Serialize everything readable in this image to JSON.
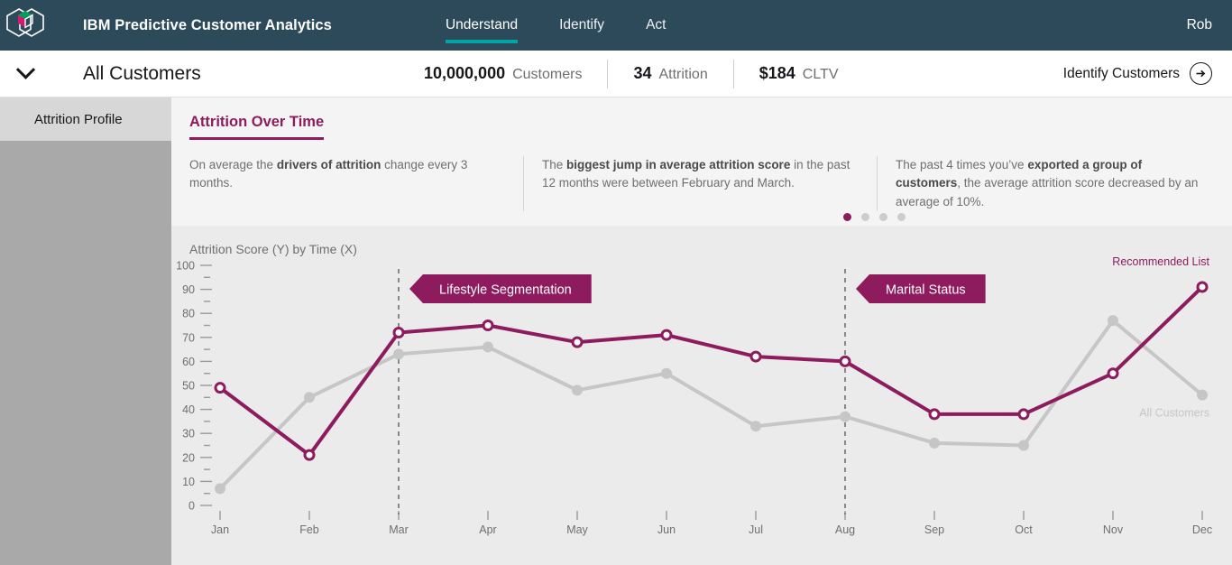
{
  "header": {
    "logo_icon": "ibm-cube-logo-icon",
    "app_title": "IBM Predictive Customer Analytics",
    "nav": [
      {
        "label": "Understand",
        "active": true
      },
      {
        "label": "Identify",
        "active": false
      },
      {
        "label": "Act",
        "active": false
      }
    ],
    "user": "Rob",
    "accent_color": "#00a5a8",
    "bg_color": "#2d4a5b"
  },
  "subheader": {
    "chevron_icon": "chevron-down-icon",
    "segment_name": "All Customers",
    "metrics": [
      {
        "value": "10,000,000",
        "label": "Customers"
      },
      {
        "value": "34",
        "label": "Attrition"
      },
      {
        "value": "$184",
        "label": "CLTV"
      }
    ],
    "cta_label": "Identify Customers",
    "cta_icon": "arrow-right-circle-icon"
  },
  "sidebar": {
    "items": [
      {
        "label": "Attrition Profile",
        "active": true
      }
    ]
  },
  "insights": {
    "title": "Attrition Over Time",
    "carousel": {
      "count": 4,
      "active_index": 0
    },
    "cards": [
      {
        "pre": "On average the ",
        "bold": "drivers of attrition",
        "post": " change every 3 months."
      },
      {
        "pre": "The ",
        "bold": "biggest jump in average attrition score",
        "post": " in the past 12 months were between February and March."
      },
      {
        "pre": "The past 4 times you’ve ",
        "bold": "exported a group of customers",
        "post": ", the average attrition score decreased by an average of 10%."
      }
    ]
  },
  "chart_data": {
    "type": "line",
    "title": "Attrition Score (Y) by Time (X)",
    "xlabel": "Time",
    "ylabel": "Attrition Score",
    "ylim": [
      0,
      100
    ],
    "ytick_step": 10,
    "yminor_step": 5,
    "grid": false,
    "legend_position": "inline-end-of-line",
    "categories": [
      "Jan",
      "Feb",
      "Mar",
      "Apr",
      "May",
      "Jun",
      "Jul",
      "Aug",
      "Sep",
      "Oct",
      "Nov",
      "Dec"
    ],
    "series": [
      {
        "name": "Recommended List",
        "color": "#8d1b5d",
        "marker": "open-circle",
        "values": [
          49,
          21,
          72,
          75,
          68,
          71,
          62,
          60,
          38,
          38,
          55,
          91
        ]
      },
      {
        "name": "All Customers",
        "color": "#c6c6c6",
        "marker": "filled-circle",
        "values": [
          7,
          45,
          63,
          66,
          48,
          55,
          33,
          37,
          26,
          25,
          77,
          46
        ]
      }
    ],
    "annotations": [
      {
        "label": "Lifestyle Segmentation",
        "at_category": "Mar",
        "style": "banner-left-arrow",
        "color": "#8d1b5d"
      },
      {
        "label": "Marital Status",
        "at_category": "Aug",
        "style": "banner-left-arrow",
        "color": "#8d1b5d"
      }
    ],
    "vertical_markers": [
      "Mar",
      "Aug"
    ]
  }
}
